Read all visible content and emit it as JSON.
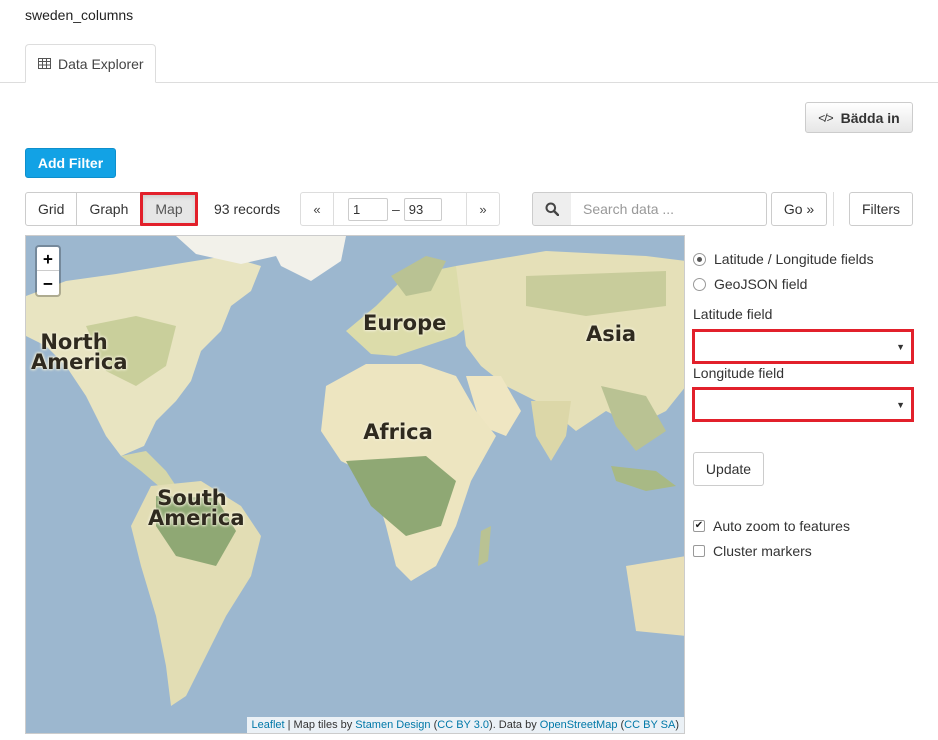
{
  "dataset": {
    "title": "sweden_columns"
  },
  "tabs": [
    {
      "label": "Data Explorer",
      "icon": "table-icon"
    }
  ],
  "embed_button": {
    "icon": "code-icon",
    "icon_text": "</>",
    "label": "Bädda in"
  },
  "add_filter_button": {
    "label": "Add Filter",
    "color": "#12a2e5"
  },
  "view_switch": {
    "grid": "Grid",
    "graph": "Graph",
    "map": "Map",
    "active": "Map",
    "highlight_color": "#e2202b"
  },
  "records": {
    "label": "93 records"
  },
  "pager": {
    "prev": "«",
    "from": "1",
    "separator": "–",
    "to": "93",
    "next": "»"
  },
  "search": {
    "icon": "search-icon",
    "placeholder": "Search data ...",
    "go": "Go »"
  },
  "filters_button": {
    "label": "Filters"
  },
  "map": {
    "zoom_in": "+",
    "zoom_out": "−",
    "labels": {
      "north_america": "North\nAmerica",
      "south_america": "South\nAmerica",
      "europe": "Europe",
      "africa": "Africa",
      "asia": "Asia"
    },
    "attribution": {
      "leaflet": "Leaflet",
      "sep1": " | Map tiles by ",
      "stamen": "Stamen Design",
      "open1": " (",
      "cc_by": "CC BY 3.0",
      "close1": "). Data by ",
      "osm": "OpenStreetMap",
      "open2": " (",
      "cc_by_sa": "CC BY SA",
      "close2": ")"
    },
    "colors": {
      "ocean": "#9cb7cf",
      "land": "#e8e4c1",
      "forest": "#8fa874",
      "link": "#0078a8"
    }
  },
  "map_settings": {
    "location_options": [
      {
        "label": "Latitude / Longitude fields",
        "checked": true
      },
      {
        "label": "GeoJSON field",
        "checked": false
      }
    ],
    "latitude_label": "Latitude field",
    "latitude_value": "",
    "longitude_label": "Longitude field",
    "longitude_value": "",
    "dropdown_arrow": "▼",
    "update_button": "Update",
    "checkboxes": [
      {
        "label": "Auto zoom to features",
        "checked": true,
        "mark": "✔"
      },
      {
        "label": "Cluster markers",
        "checked": false,
        "mark": ""
      }
    ]
  }
}
